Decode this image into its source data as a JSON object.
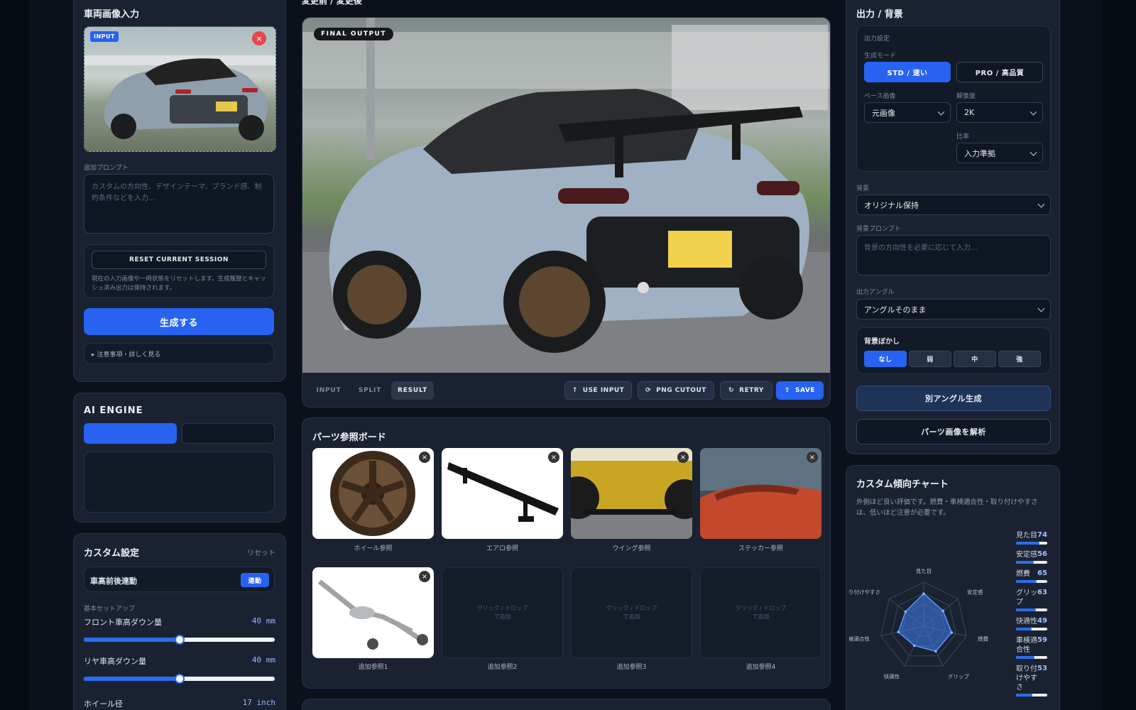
{
  "left": {
    "input_title": "車両画像入力",
    "input_badge": "INPUT",
    "prompt_label": "追加プロンプト",
    "prompt_placeholder": "カスタムの方向性、デザインテーマ、ブランド感、制約条件などを入力...",
    "reset_button": "RESET CURRENT SESSION",
    "reset_note": "現在の入力画像や一時状態をリセットします。生成履歴とキャッシュ済み出力は保持されます。",
    "generate_button": "生成する",
    "notes_link": "▸ 注意事項・詳しく見る",
    "engine_title": "AI ENGINE",
    "custom_title": "カスタム設定",
    "custom_reset": "リセット",
    "link_label": "車高前後連動",
    "link_toggle": "連動",
    "basic_setup": "基本セットアップ",
    "front_label": "フロント車高ダウン量",
    "front_value": "40 mm",
    "front_fraction": 0.5,
    "rear_label": "リヤ車高ダウン量",
    "rear_value": "40 mm",
    "rear_fraction": 0.5,
    "wheel_label": "ホイール径",
    "wheel_value": "17 inch"
  },
  "center": {
    "top_label": "変更前 / 変更後",
    "output_badge": "FINAL OUTPUT",
    "tabs": [
      "INPUT",
      "SPLIT",
      "RESULT"
    ],
    "active_tab": "RESULT",
    "actions": [
      "USE INPUT",
      "PNG CUTOUT",
      "RETRY",
      "SAVE"
    ],
    "board_title": "パーツ参照ボード",
    "parts": [
      {
        "label": "ホイール参照"
      },
      {
        "label": "エアロ参照"
      },
      {
        "label": "ウイング参照"
      },
      {
        "label": "ステッカー参照"
      },
      {
        "label": "追加参照1"
      },
      {
        "label": "追加参照2"
      },
      {
        "label": "追加参照3"
      },
      {
        "label": "追加参照4"
      }
    ],
    "empty_slot_text": "クリック / ドロップ\nで追加"
  },
  "right": {
    "title": "出力 / 背景",
    "output_settings": "出力設定",
    "mode_label": "生成モード",
    "mode_std": "STD / 速い",
    "mode_pro": "PRO / 高品質",
    "base_label": "ベース画像",
    "base_value": "元画像",
    "res_label": "解像度",
    "res_value": "2K",
    "ratio_label": "比率",
    "ratio_value": "入力準拠",
    "bg_label": "背景",
    "bg_value": "オリジナル保持",
    "bg_prompt_label": "背景プロンプト",
    "bg_prompt_placeholder": "背景の方向性を必要に応じて入力...",
    "angle_label": "出力アングル",
    "angle_value": "アングルそのまま",
    "blur_label": "背景ぼかし",
    "blur_options": [
      "なし",
      "弱",
      "中",
      "強"
    ],
    "blur_active": "なし",
    "alt_angle_button": "別アングル生成",
    "analyze_button": "パーツ画像を解析",
    "chart_title": "カスタム傾向チャート",
    "chart_desc": "外側ほど良い評価です。燃費・車検適合性・取り付けやすさは、低いほど注意が必要です。"
  },
  "chart_data": {
    "type": "radar",
    "axes": [
      "見た目",
      "安定感",
      "燃費",
      "グリップ",
      "快適性",
      "車検適合性",
      "取り付けやすさ"
    ],
    "values": [
      74,
      56,
      65,
      63,
      49,
      59,
      53
    ],
    "max": 100,
    "legend": [
      {
        "label": "見た目",
        "value": "74"
      },
      {
        "label": "安定感",
        "value": "56"
      },
      {
        "label": "燃費",
        "value": "65"
      },
      {
        "label": "グリッ\nプ",
        "value": "63"
      },
      {
        "label": "快適性",
        "value": "49"
      },
      {
        "label": "車検適\n合性",
        "value": "59"
      },
      {
        "label": "取り付\nけやす\nさ",
        "value": "53"
      }
    ]
  },
  "colors": {
    "accent": "#2763f0",
    "panel": "#1a2232",
    "background": "#0b101a"
  }
}
